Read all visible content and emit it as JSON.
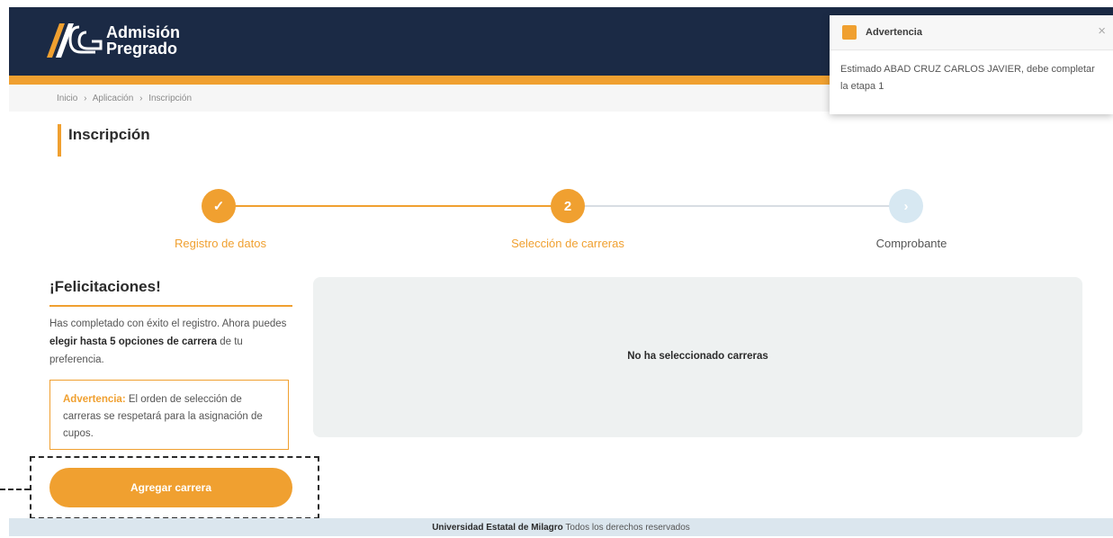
{
  "header": {
    "logo_line1": "Admisión",
    "logo_line2": "Pregrado"
  },
  "breadcrumb": [
    "Inicio",
    "›",
    "Aplicación",
    "›",
    "Inscripción"
  ],
  "page_title": "Inscripción",
  "stepper": {
    "steps": [
      {
        "label": "Registro de datos",
        "marker": "✓",
        "state": "done"
      },
      {
        "label": "Selección de carreras",
        "marker": "2",
        "state": "active"
      },
      {
        "label": "Comprobante",
        "marker": "›",
        "state": "pending"
      }
    ]
  },
  "left": {
    "title": "¡Felicitaciones!",
    "text_before": "Has completado con éxito el registro. Ahora puedes ",
    "text_bold": "elegir hasta 5 opciones de carrera",
    "text_after": " de tu preferencia.",
    "warning_label": "Advertencia:",
    "warning_text": " El orden de selección de carreras se respetará para la asignación de cupos.",
    "add_button": "Agregar carrera"
  },
  "empty_panel": {
    "text": "No ha seleccionado carreras"
  },
  "footer": {
    "bold": "Universidad Estatal de Milagro",
    "text": " Todos los derechos reservados"
  },
  "toast": {
    "title": "Advertencia",
    "message": "Estimado ABAD CRUZ CARLOS JAVIER, debe completar la etapa 1",
    "close": "×"
  },
  "colors": {
    "accent": "#f0a030",
    "header": "#1b2a45"
  }
}
